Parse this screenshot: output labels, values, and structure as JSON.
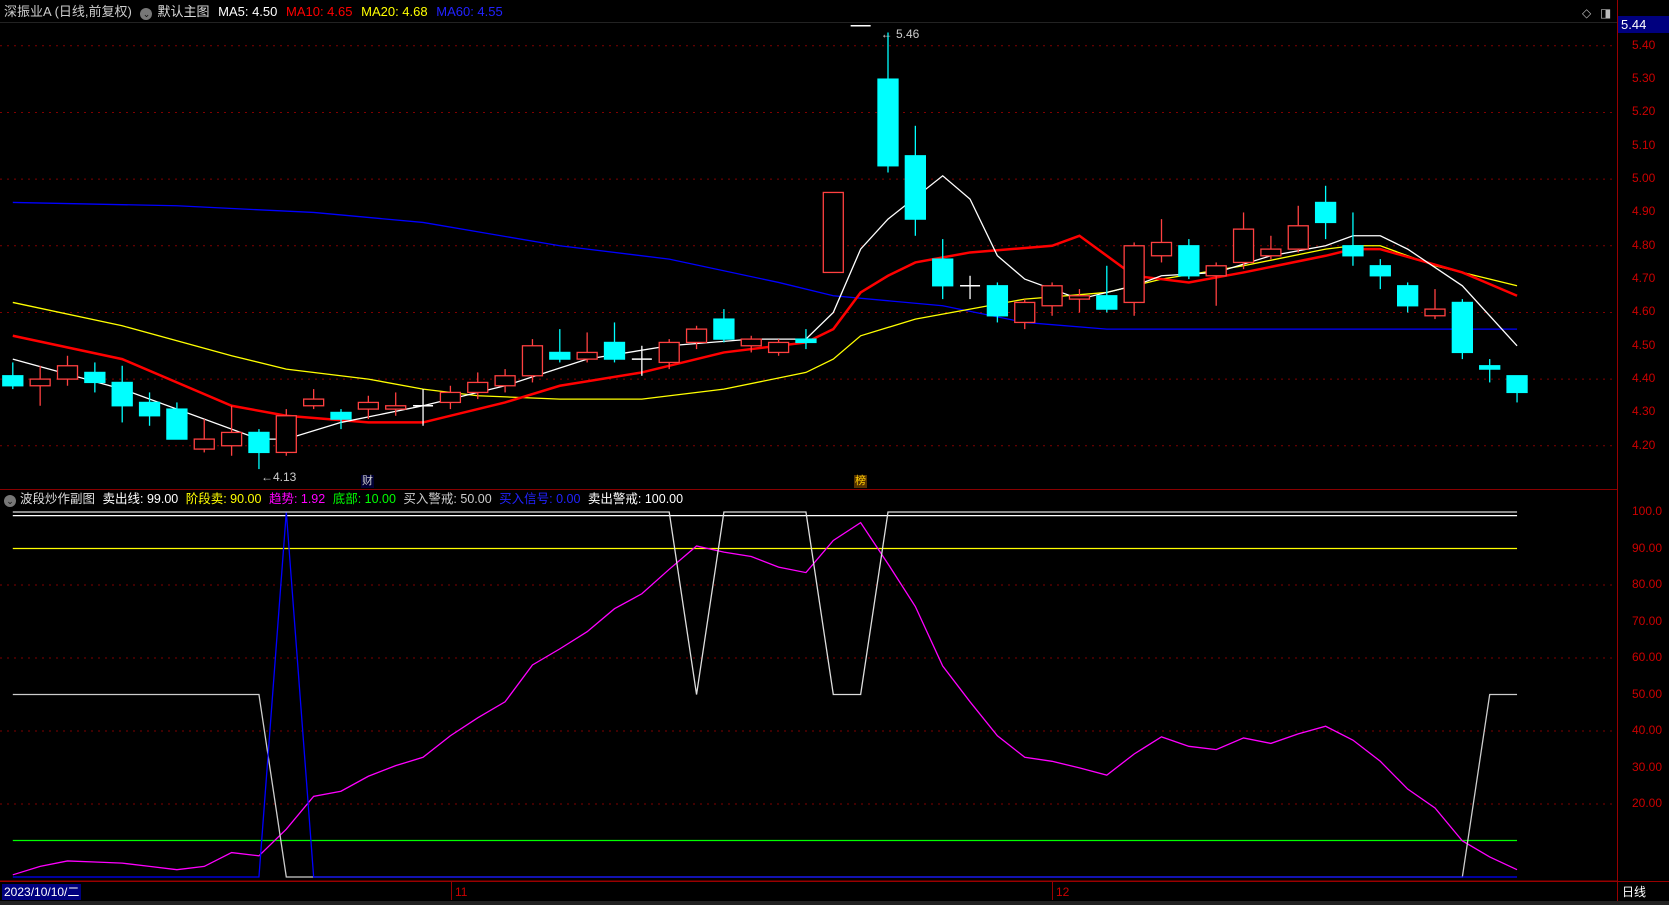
{
  "header": {
    "stock": "深振业A (日线,前复权)",
    "chart_name": "默认主图",
    "ma5": "MA5: 4.50",
    "ma10": "MA10: 4.65",
    "ma20": "MA20: 4.68",
    "ma60": "MA60: 4.55"
  },
  "indicator_header": {
    "name": "波段炒作副图",
    "sell_line": "卖出线: 99.00",
    "stage_sell": "阶段卖: 90.00",
    "trend": "趋势: 1.92",
    "bottom": "底部: 10.00",
    "buy_warn": "买入警戒: 50.00",
    "buy_signal": "买入信号: 0.00",
    "sell_warn": "卖出警戒: 100.00"
  },
  "colors": {
    "up": "#ff4040",
    "down": "#00ffff",
    "ma5": "#ffffff",
    "ma10": "#ff0000",
    "ma20": "#ffff00",
    "ma60": "#0000ff",
    "trend": "#ff00ff",
    "grid": "#800000",
    "axis_text": "#cc0000"
  },
  "price_badge": "5.44",
  "price_axis": [
    "5.40",
    "5.30",
    "5.20",
    "5.10",
    "5.00",
    "4.90",
    "4.80",
    "4.70",
    "4.60",
    "4.50",
    "4.40",
    "4.30",
    "4.20"
  ],
  "indicator_axis": [
    "100.0",
    "90.00",
    "80.00",
    "70.00",
    "60.00",
    "50.00",
    "40.00",
    "30.00",
    "20.00"
  ],
  "high_label": "5.46",
  "low_label": "4.13",
  "markers": {
    "cai": "财",
    "bang": "榜"
  },
  "x_axis": {
    "start_date": "2023/10/10/二",
    "m11": "11",
    "m12": "12",
    "period": "日线"
  },
  "chart_data": [
    {
      "type": "candlestick",
      "title": "深振业A 日线",
      "ylim": [
        4.1,
        5.5
      ],
      "ohlc": [
        [
          4.41,
          4.45,
          4.37,
          4.38
        ],
        [
          4.38,
          4.44,
          4.32,
          4.4
        ],
        [
          4.4,
          4.47,
          4.38,
          4.44
        ],
        [
          4.42,
          4.45,
          4.36,
          4.39
        ],
        [
          4.39,
          4.44,
          4.27,
          4.32
        ],
        [
          4.33,
          4.36,
          4.26,
          4.29
        ],
        [
          4.31,
          4.33,
          4.22,
          4.22
        ],
        [
          4.19,
          4.28,
          4.18,
          4.22
        ],
        [
          4.2,
          4.32,
          4.17,
          4.24
        ],
        [
          4.24,
          4.25,
          4.13,
          4.18
        ],
        [
          4.18,
          4.31,
          4.17,
          4.29
        ],
        [
          4.32,
          4.37,
          4.31,
          4.34
        ],
        [
          4.3,
          4.31,
          4.25,
          4.28
        ],
        [
          4.31,
          4.35,
          4.28,
          4.33
        ],
        [
          4.31,
          4.36,
          4.29,
          4.32
        ],
        [
          4.32,
          4.37,
          4.26,
          4.32
        ],
        [
          4.33,
          4.38,
          4.31,
          4.36
        ],
        [
          4.36,
          4.42,
          4.34,
          4.39
        ],
        [
          4.38,
          4.43,
          4.36,
          4.41
        ],
        [
          4.41,
          4.52,
          4.39,
          4.5
        ],
        [
          4.48,
          4.55,
          4.45,
          4.46
        ],
        [
          4.46,
          4.54,
          4.45,
          4.48
        ],
        [
          4.51,
          4.57,
          4.45,
          4.46
        ],
        [
          4.46,
          4.5,
          4.41,
          4.46
        ],
        [
          4.45,
          4.52,
          4.43,
          4.51
        ],
        [
          4.51,
          4.56,
          4.49,
          4.55
        ],
        [
          4.58,
          4.61,
          4.51,
          4.52
        ],
        [
          4.5,
          4.53,
          4.48,
          4.52
        ],
        [
          4.48,
          4.52,
          4.47,
          4.51
        ],
        [
          4.52,
          4.55,
          4.49,
          4.51
        ],
        [
          4.72,
          4.96,
          4.72,
          4.96
        ],
        [
          5.46,
          5.46,
          5.46,
          5.46
        ],
        [
          5.3,
          5.44,
          5.02,
          5.04
        ],
        [
          5.07,
          5.16,
          4.83,
          4.88
        ],
        [
          4.76,
          4.82,
          4.64,
          4.68
        ],
        [
          4.68,
          4.71,
          4.64,
          4.68
        ],
        [
          4.68,
          4.69,
          4.57,
          4.59
        ],
        [
          4.57,
          4.64,
          4.55,
          4.63
        ],
        [
          4.62,
          4.69,
          4.59,
          4.68
        ],
        [
          4.64,
          4.67,
          4.6,
          4.65
        ],
        [
          4.65,
          4.74,
          4.6,
          4.61
        ],
        [
          4.63,
          4.81,
          4.59,
          4.8
        ],
        [
          4.77,
          4.88,
          4.75,
          4.81
        ],
        [
          4.8,
          4.82,
          4.7,
          4.71
        ],
        [
          4.71,
          4.75,
          4.62,
          4.74
        ],
        [
          4.75,
          4.9,
          4.73,
          4.85
        ],
        [
          4.77,
          4.83,
          4.76,
          4.79
        ],
        [
          4.79,
          4.92,
          4.78,
          4.86
        ],
        [
          4.93,
          4.98,
          4.82,
          4.87
        ],
        [
          4.8,
          4.9,
          4.74,
          4.77
        ],
        [
          4.74,
          4.76,
          4.67,
          4.71
        ],
        [
          4.68,
          4.69,
          4.6,
          4.62
        ],
        [
          4.59,
          4.67,
          4.58,
          4.61
        ],
        [
          4.63,
          4.64,
          4.46,
          4.48
        ],
        [
          4.44,
          4.46,
          4.39,
          4.43
        ],
        [
          4.41,
          4.41,
          4.33,
          4.36
        ]
      ],
      "ma": {
        "MA5": [
          [
            0,
            4.46
          ],
          [
            4,
            4.37
          ],
          [
            9,
            4.22
          ],
          [
            10,
            4.22
          ],
          [
            12,
            4.27
          ],
          [
            15,
            4.32
          ],
          [
            18,
            4.38
          ],
          [
            21,
            4.46
          ],
          [
            24,
            4.5
          ],
          [
            27,
            4.52
          ],
          [
            29,
            4.52
          ],
          [
            30,
            4.6
          ],
          [
            31,
            4.79
          ],
          [
            32,
            4.88
          ],
          [
            34,
            5.01
          ],
          [
            35,
            4.94
          ],
          [
            36,
            4.77
          ],
          [
            37,
            4.7
          ],
          [
            39,
            4.64
          ],
          [
            41,
            4.68
          ],
          [
            42,
            4.71
          ],
          [
            44,
            4.72
          ],
          [
            46,
            4.77
          ],
          [
            48,
            4.8
          ],
          [
            49,
            4.83
          ],
          [
            50,
            4.83
          ],
          [
            51,
            4.79
          ],
          [
            53,
            4.68
          ],
          [
            55,
            4.5
          ]
        ],
        "MA10": [
          [
            0,
            4.53
          ],
          [
            4,
            4.46
          ],
          [
            8,
            4.32
          ],
          [
            10,
            4.29
          ],
          [
            13,
            4.27
          ],
          [
            15,
            4.27
          ],
          [
            18,
            4.33
          ],
          [
            20,
            4.38
          ],
          [
            23,
            4.42
          ],
          [
            26,
            4.48
          ],
          [
            29,
            4.51
          ],
          [
            30,
            4.55
          ],
          [
            31,
            4.66
          ],
          [
            32,
            4.71
          ],
          [
            33,
            4.75
          ],
          [
            35,
            4.78
          ],
          [
            38,
            4.8
          ],
          [
            39,
            4.83
          ],
          [
            40,
            4.77
          ],
          [
            41,
            4.71
          ],
          [
            43,
            4.69
          ],
          [
            45,
            4.72
          ],
          [
            48,
            4.77
          ],
          [
            49,
            4.79
          ],
          [
            50,
            4.79
          ],
          [
            53,
            4.72
          ],
          [
            55,
            4.65
          ]
        ],
        "MA20": [
          [
            0,
            4.63
          ],
          [
            4,
            4.56
          ],
          [
            8,
            4.47
          ],
          [
            10,
            4.43
          ],
          [
            13,
            4.4
          ],
          [
            15,
            4.37
          ],
          [
            17,
            4.35
          ],
          [
            20,
            4.34
          ],
          [
            23,
            4.34
          ],
          [
            26,
            4.37
          ],
          [
            29,
            4.42
          ],
          [
            30,
            4.46
          ],
          [
            31,
            4.53
          ],
          [
            33,
            4.58
          ],
          [
            35,
            4.61
          ],
          [
            37,
            4.64
          ],
          [
            40,
            4.66
          ],
          [
            42,
            4.7
          ],
          [
            45,
            4.74
          ],
          [
            48,
            4.79
          ],
          [
            49,
            4.8
          ],
          [
            50,
            4.8
          ],
          [
            52,
            4.74
          ],
          [
            55,
            4.68
          ]
        ],
        "MA60": [
          [
            0,
            4.93
          ],
          [
            6,
            4.92
          ],
          [
            11,
            4.9
          ],
          [
            15,
            4.87
          ],
          [
            20,
            4.8
          ],
          [
            24,
            4.76
          ],
          [
            28,
            4.69
          ],
          [
            30,
            4.65
          ],
          [
            34,
            4.62
          ],
          [
            37,
            4.57
          ],
          [
            40,
            4.55
          ],
          [
            44,
            4.55
          ],
          [
            50,
            4.55
          ],
          [
            55,
            4.55
          ]
        ]
      }
    },
    {
      "type": "line",
      "title": "波段炒作副图",
      "ylim": [
        0,
        100
      ],
      "series": [
        {
          "name": "卖出线",
          "constant": 99
        },
        {
          "name": "阶段卖",
          "constant": 90
        },
        {
          "name": "底部",
          "constant": 10
        },
        {
          "name": "趋势",
          "values": [
            0.6,
            2.9,
            4.4,
            4.1,
            3.8,
            2.9,
            2.0,
            2.9,
            6.7,
            5.8,
            13.1,
            22.1,
            23.5,
            27.6,
            30.5,
            32.8,
            38.7,
            43.6,
            48.0,
            58.1,
            62.5,
            67.2,
            73.5,
            77.6,
            84.3,
            90.7,
            89.0,
            87.8,
            84.9,
            83.4,
            92.2,
            97.1,
            85.8,
            74.1,
            57.8,
            48.0,
            38.7,
            32.8,
            31.7,
            29.9,
            27.9,
            33.7,
            38.4,
            35.8,
            34.9,
            38.1,
            36.6,
            39.2,
            41.3,
            37.5,
            31.7,
            24.1,
            18.9,
            9.9,
            5.5,
            2.0
          ]
        },
        {
          "name": "买入警戒",
          "values": [
            50,
            50,
            50,
            50,
            50,
            50,
            50,
            50,
            50,
            50,
            0,
            0,
            0,
            0,
            0,
            0,
            0,
            0,
            0,
            0,
            0,
            0,
            0,
            0,
            0,
            0,
            0,
            0,
            0,
            0,
            0,
            0,
            0,
            0,
            0,
            0,
            0,
            0,
            0,
            0,
            0,
            0,
            0,
            0,
            0,
            0,
            0,
            0,
            0,
            0,
            0,
            0,
            0,
            0,
            50,
            50
          ]
        },
        {
          "name": "买入信号",
          "values": [
            0,
            0,
            0,
            0,
            0,
            0,
            0,
            0,
            0,
            0,
            100,
            0,
            0,
            0,
            0,
            0,
            0,
            0,
            0,
            0,
            0,
            0,
            0,
            0,
            0,
            0,
            0,
            0,
            0,
            0,
            0,
            0,
            0,
            0,
            0,
            0,
            0,
            0,
            0,
            0,
            0,
            0,
            0,
            0,
            0,
            0,
            0,
            0,
            0,
            0,
            0,
            0,
            0,
            0,
            0,
            0
          ]
        },
        {
          "name": "卖出警戒",
          "values": [
            100,
            100,
            100,
            100,
            100,
            100,
            100,
            100,
            100,
            100,
            100,
            100,
            100,
            100,
            100,
            100,
            100,
            100,
            100,
            100,
            100,
            100,
            100,
            100,
            100,
            50,
            100,
            100,
            100,
            100,
            50,
            50,
            100,
            100,
            100,
            100,
            100,
            100,
            100,
            100,
            100,
            100,
            100,
            100,
            100,
            100,
            100,
            100,
            100,
            100,
            100,
            100,
            100,
            100,
            100,
            100
          ]
        }
      ]
    }
  ]
}
